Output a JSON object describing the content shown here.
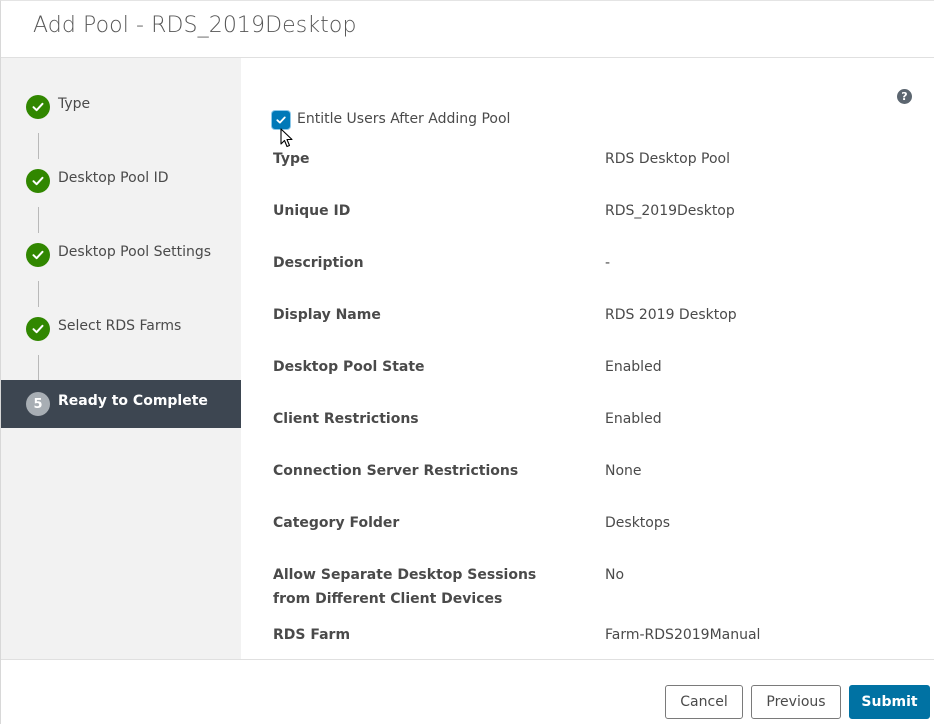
{
  "dialog": {
    "title": "Add Pool - RDS_2019Desktop"
  },
  "steps": [
    {
      "label": "Type",
      "status": "complete",
      "icon": "check-icon"
    },
    {
      "label": "Desktop Pool ID",
      "status": "complete",
      "icon": "check-icon"
    },
    {
      "label": "Desktop Pool Settings",
      "status": "complete",
      "icon": "check-icon"
    },
    {
      "label": "Select RDS Farms",
      "status": "complete",
      "icon": "check-icon"
    },
    {
      "label": "Ready to Complete",
      "status": "active",
      "number": "5"
    }
  ],
  "entitle": {
    "label": "Entitle Users After Adding Pool",
    "checked": true
  },
  "help_icon": "question-circle-icon",
  "summary": [
    {
      "key": "Type",
      "value": "RDS Desktop Pool"
    },
    {
      "key": "Unique ID",
      "value": "RDS_2019Desktop"
    },
    {
      "key": "Description",
      "value": "-"
    },
    {
      "key": "Display Name",
      "value": "RDS 2019 Desktop"
    },
    {
      "key": "Desktop Pool State",
      "value": "Enabled"
    },
    {
      "key": "Client Restrictions",
      "value": "Enabled"
    },
    {
      "key": "Connection Server Restrictions",
      "value": "None"
    },
    {
      "key": "Category Folder",
      "value": "Desktops"
    },
    {
      "key": "Allow Separate Desktop Sessions from Different Client Devices",
      "value": "No"
    },
    {
      "key": "RDS Farm",
      "value": "Farm-RDS2019Manual"
    }
  ],
  "footer": {
    "cancel_label": "Cancel",
    "previous_label": "Previous",
    "submit_label": "Submit"
  },
  "colors": {
    "complete": "#318700",
    "active_bg": "#3d4651",
    "primary": "#0072a3"
  }
}
